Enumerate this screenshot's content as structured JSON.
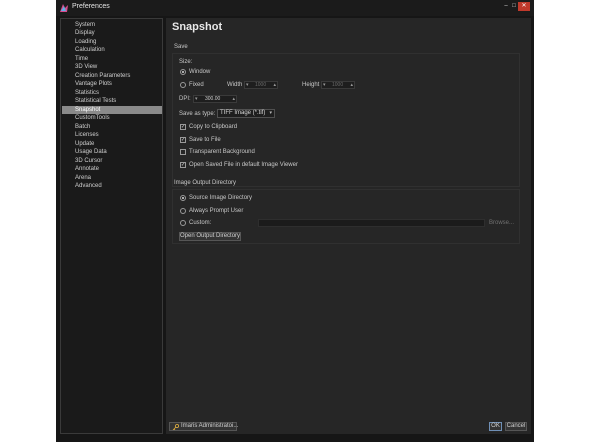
{
  "window": {
    "title": "Preferences",
    "minimize": "‒",
    "maximize": "□",
    "close": "✕"
  },
  "sidebar": {
    "items": [
      {
        "label": "System"
      },
      {
        "label": "Display"
      },
      {
        "label": "Loading"
      },
      {
        "label": "Calculation"
      },
      {
        "label": "Time"
      },
      {
        "label": "3D View"
      },
      {
        "label": "Creation Parameters"
      },
      {
        "label": "Vantage Plots"
      },
      {
        "label": "Statistics"
      },
      {
        "label": "Statistical Tests"
      },
      {
        "label": "Snapshot"
      },
      {
        "label": "CustomTools"
      },
      {
        "label": "Batch"
      },
      {
        "label": "Licenses"
      },
      {
        "label": "Update"
      },
      {
        "label": "Usage Data"
      },
      {
        "label": "3D Cursor"
      },
      {
        "label": "Annotate"
      },
      {
        "label": "Arena"
      },
      {
        "label": "Advanced"
      }
    ],
    "active": "Snapshot"
  },
  "page": {
    "title": "Snapshot",
    "save": {
      "group_label": "Save",
      "size_label": "Size:",
      "window_option": "Window",
      "fixed_option": "Fixed",
      "width_label": "Width",
      "width_value": "1000",
      "height_label": "Height",
      "height_value": "1000",
      "dpi_label": "DPI:",
      "dpi_value": "300.00",
      "save_as_type_label": "Save as type:",
      "save_as_type_value": "TIFF Image (*.tif)",
      "copy_to_clipboard": "Copy to Clipboard",
      "save_to_file": "Save to File",
      "transparent_background": "Transparent Background",
      "open_saved_file": "Open Saved File in default Image Viewer"
    },
    "output": {
      "group_label": "Image Output Directory",
      "source_option": "Source Image Directory",
      "prompt_option": "Always Prompt User",
      "custom_option": "Custom:",
      "browse": "Browse...",
      "open_output": "Open Output Directory"
    }
  },
  "footer": {
    "user_button": "Imaris Administratoi...",
    "ok": "OK",
    "cancel": "Cancel"
  },
  "icons": {
    "key": "key-icon",
    "app": "imaris-app-icon"
  }
}
